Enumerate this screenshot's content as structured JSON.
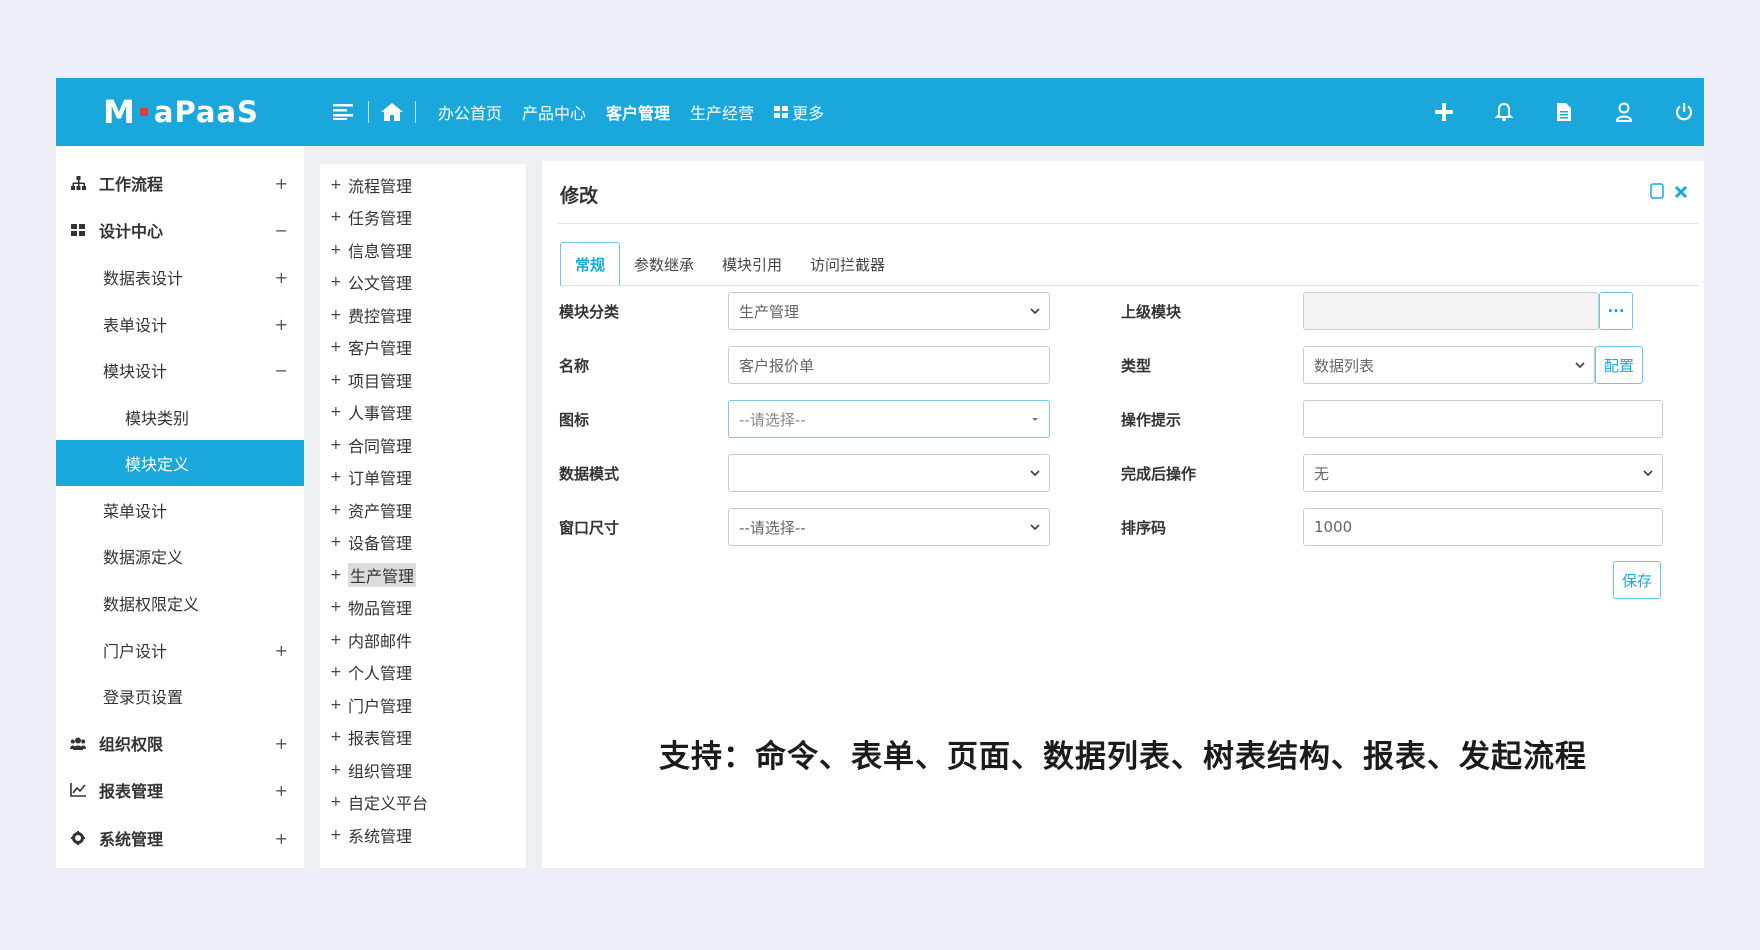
{
  "header": {
    "logo_text": "aPaaS",
    "nav": [
      "办公首页",
      "产品中心",
      "客户管理",
      "生产经营"
    ],
    "nav_active": "客户管理",
    "more_label": "更多"
  },
  "sidebar": {
    "items": [
      {
        "label": "工作流程",
        "toggle": "+",
        "icon": "sitemap-icon",
        "level": 0
      },
      {
        "label": "设计中心",
        "toggle": "−",
        "icon": "grid-icon",
        "level": 0
      },
      {
        "label": "数据表设计",
        "toggle": "+",
        "level": 1
      },
      {
        "label": "表单设计",
        "toggle": "+",
        "level": 1
      },
      {
        "label": "模块设计",
        "toggle": "−",
        "level": 1
      },
      {
        "label": "模块类别",
        "toggle": "",
        "level": 2
      },
      {
        "label": "模块定义",
        "toggle": "",
        "level": 2,
        "active": true
      },
      {
        "label": "菜单设计",
        "toggle": "",
        "level": 1
      },
      {
        "label": "数据源定义",
        "toggle": "",
        "level": 1
      },
      {
        "label": "数据权限定义",
        "toggle": "",
        "level": 1
      },
      {
        "label": "门户设计",
        "toggle": "+",
        "level": 1
      },
      {
        "label": "登录页设置",
        "toggle": "",
        "level": 1
      },
      {
        "label": "组织权限",
        "toggle": "+",
        "icon": "users-icon",
        "level": 0
      },
      {
        "label": "报表管理",
        "toggle": "+",
        "icon": "line-chart-icon",
        "level": 0
      },
      {
        "label": "系统管理",
        "toggle": "+",
        "icon": "gear-icon",
        "level": 0
      }
    ]
  },
  "modules": {
    "items": [
      "流程管理",
      "任务管理",
      "信息管理",
      "公文管理",
      "费控管理",
      "客户管理",
      "项目管理",
      "人事管理",
      "合同管理",
      "订单管理",
      "资产管理",
      "设备管理",
      "生产管理",
      "物品管理",
      "内部邮件",
      "个人管理",
      "门户管理",
      "报表管理",
      "组织管理",
      "自定义平台",
      "系统管理"
    ],
    "highlighted": "生产管理"
  },
  "form": {
    "title": "修改",
    "tabs": [
      "常规",
      "参数继承",
      "模块引用",
      "访问拦截器"
    ],
    "active_tab": "常规",
    "fields": {
      "module_category": {
        "label": "模块分类",
        "value": "生产管理"
      },
      "parent_module": {
        "label": "上级模块",
        "value": "",
        "button": "···"
      },
      "name": {
        "label": "名称",
        "value": "客户报价单"
      },
      "type": {
        "label": "类型",
        "value": "数据列表",
        "button": "配置"
      },
      "icon": {
        "label": "图标",
        "value": "--请选择--"
      },
      "operation_hint": {
        "label": "操作提示",
        "value": ""
      },
      "data_mode": {
        "label": "数据模式",
        "value": ""
      },
      "after_complete": {
        "label": "完成后操作",
        "value": "无"
      },
      "window_size": {
        "label": "窗口尺寸",
        "value": "--请选择--"
      },
      "sort_code": {
        "label": "排序码",
        "value": "1000"
      }
    },
    "save_label": "保存"
  },
  "caption": "支持：命令、表单、页面、数据列表、树表结构、报表、发起流程",
  "colors": {
    "brand": "#1aa8dc",
    "logo_dot": "#e83a3a"
  }
}
